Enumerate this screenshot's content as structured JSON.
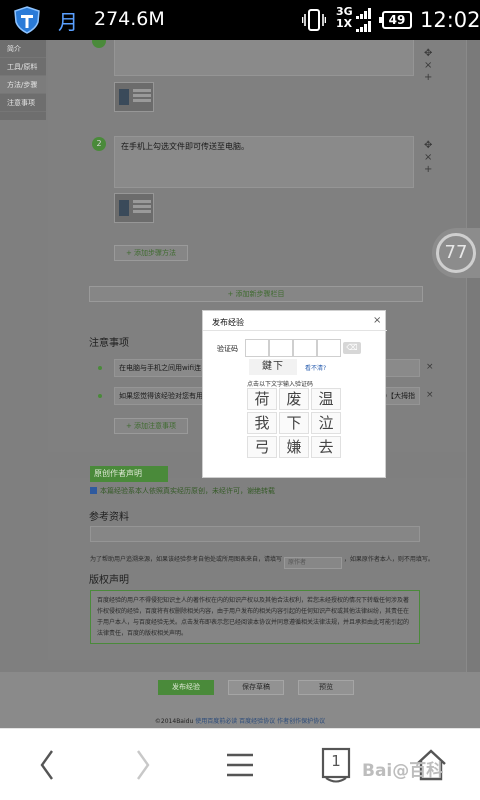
{
  "status": {
    "moon_glyph": "月",
    "memory": "274.6M",
    "network_type_top": "3G",
    "network_type_bottom": "1X",
    "battery": "49",
    "time": "12:02"
  },
  "leftnav": {
    "items": [
      "简介",
      "工具/原料",
      "方法/步骤",
      "注意事项"
    ]
  },
  "steps": [
    {
      "number": "",
      "text": ""
    },
    {
      "number": "2",
      "text": "在手机上勾选文件即可传送至电脑。"
    }
  ],
  "controls": {
    "move": "✥",
    "delete": "×",
    "add": "+"
  },
  "buttons": {
    "add_step_method": "+ 添加步骤方法",
    "add_new_step_section": "+ 添加新步骤栏目",
    "add_note": "+ 添加注意事项"
  },
  "notes": {
    "title": "注意事项",
    "items": [
      "在电脑与手机之间用wifi连",
      "如果您觉得该经验对您有用"
    ],
    "tail_2": ")【大拇指"
  },
  "original": {
    "tag": "原创作者声明",
    "checkbox_text": "本篇经验系本人依照真实经历原创，未经许可，谢绝转载"
  },
  "references": {
    "title": "参考资料",
    "note_before": "为了帮助用户追溯来源，如果该经验参考自他处或所用图表来自，请填写",
    "placeholder": "原作者",
    "note_after": "，如果原作者本人，则不用填写。"
  },
  "copyright": {
    "title": "版权声明",
    "text": "百度经验的用户不得侵犯知识主人的著作权在内的知识产权以及其他合法权利，若您未经授权的情况下转载任何涉及著作权侵权的经验，百度将有权删除相关内容，由于用户发布的相关内容引起的任何知识产权或其他法律纠纷，其责任在于用户本人，与百度经验无关。点击发布即表示您已经阅读本协议并同意遵循相关法律法规，并且承担由此可能引起的法律责任，百度的版权相关声明。"
  },
  "actions": {
    "publish": "发布经验",
    "save_draft": "保存草稿",
    "preview": "预览"
  },
  "footer": {
    "copyright": "©2014Baidu",
    "links": [
      "使用百度前必读",
      "百度经验协议",
      "作者创作保护协议"
    ]
  },
  "timer": {
    "value": "77"
  },
  "modal": {
    "title": "发布经验",
    "close": "×",
    "captcha_label": "验证码",
    "delete_key": "⌫",
    "captcha_image_text": "鍵下",
    "refresh_link": "看不清?",
    "hint": "点击以下文字输入验证码",
    "characters": [
      "荷",
      "废",
      "温",
      "我",
      "下",
      "泣",
      "弓",
      "嫌",
      "去"
    ]
  },
  "nav": {
    "tabs_count": "1"
  },
  "watermark": "Bai@百科",
  "colors": {
    "accent_green": "#4a8a3a",
    "link_blue": "#2b5fb0",
    "status_moon": "#5aa0ff"
  },
  "icons": [
    "shield-icon",
    "vibrate-icon",
    "signal-icon",
    "battery-icon",
    "back-icon",
    "forward-icon",
    "menu-icon",
    "tabs-icon",
    "home-icon"
  ]
}
